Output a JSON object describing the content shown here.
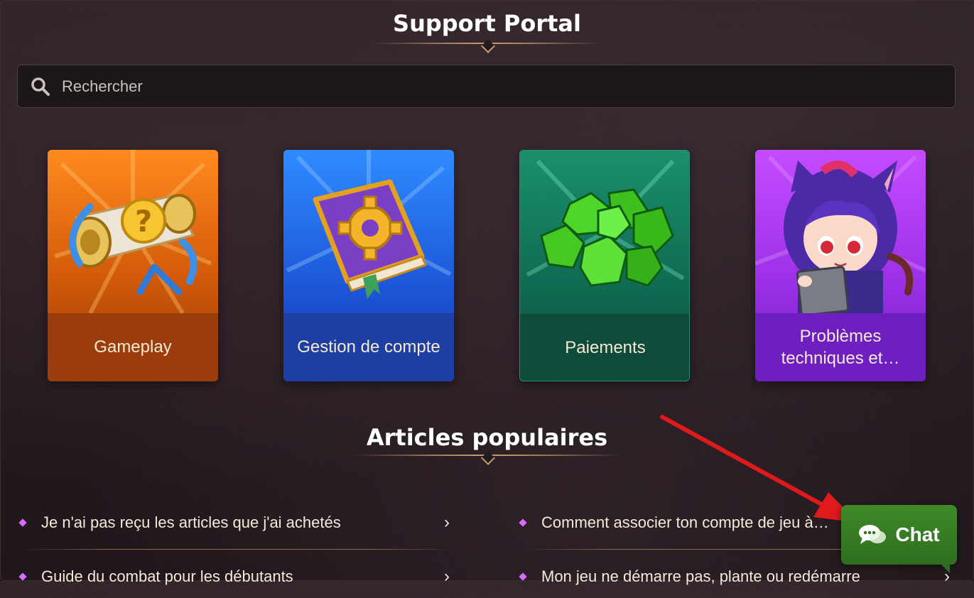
{
  "header": {
    "title": "Support Portal"
  },
  "search": {
    "placeholder": "Rechercher"
  },
  "categories": [
    {
      "label": "Gameplay",
      "color": "#d25a09",
      "icon": "scroll-question-icon"
    },
    {
      "label": "Gestion de compte",
      "color": "#1c56d8",
      "icon": "book-gear-icon"
    },
    {
      "label": "Paiements",
      "color": "#0f6a52",
      "icon": "gems-icon"
    },
    {
      "label": "Problèmes techniques et…",
      "color": "#9a2fe6",
      "icon": "catgirl-tablet-icon"
    }
  ],
  "articles": {
    "title": "Articles populaires",
    "items": [
      {
        "text": "Je n'ai pas reçu les articles que j'ai achetés"
      },
      {
        "text": "Comment associer ton compte de jeu à…"
      },
      {
        "text": "Guide du combat pour les débutants"
      },
      {
        "text": "Mon jeu ne démarre pas, plante ou redémarre"
      }
    ]
  },
  "chat": {
    "label": "Chat",
    "icon": "chat-bubbles-icon",
    "color": "#3f8a2a"
  },
  "annotation": {
    "color": "#e01a1a"
  }
}
